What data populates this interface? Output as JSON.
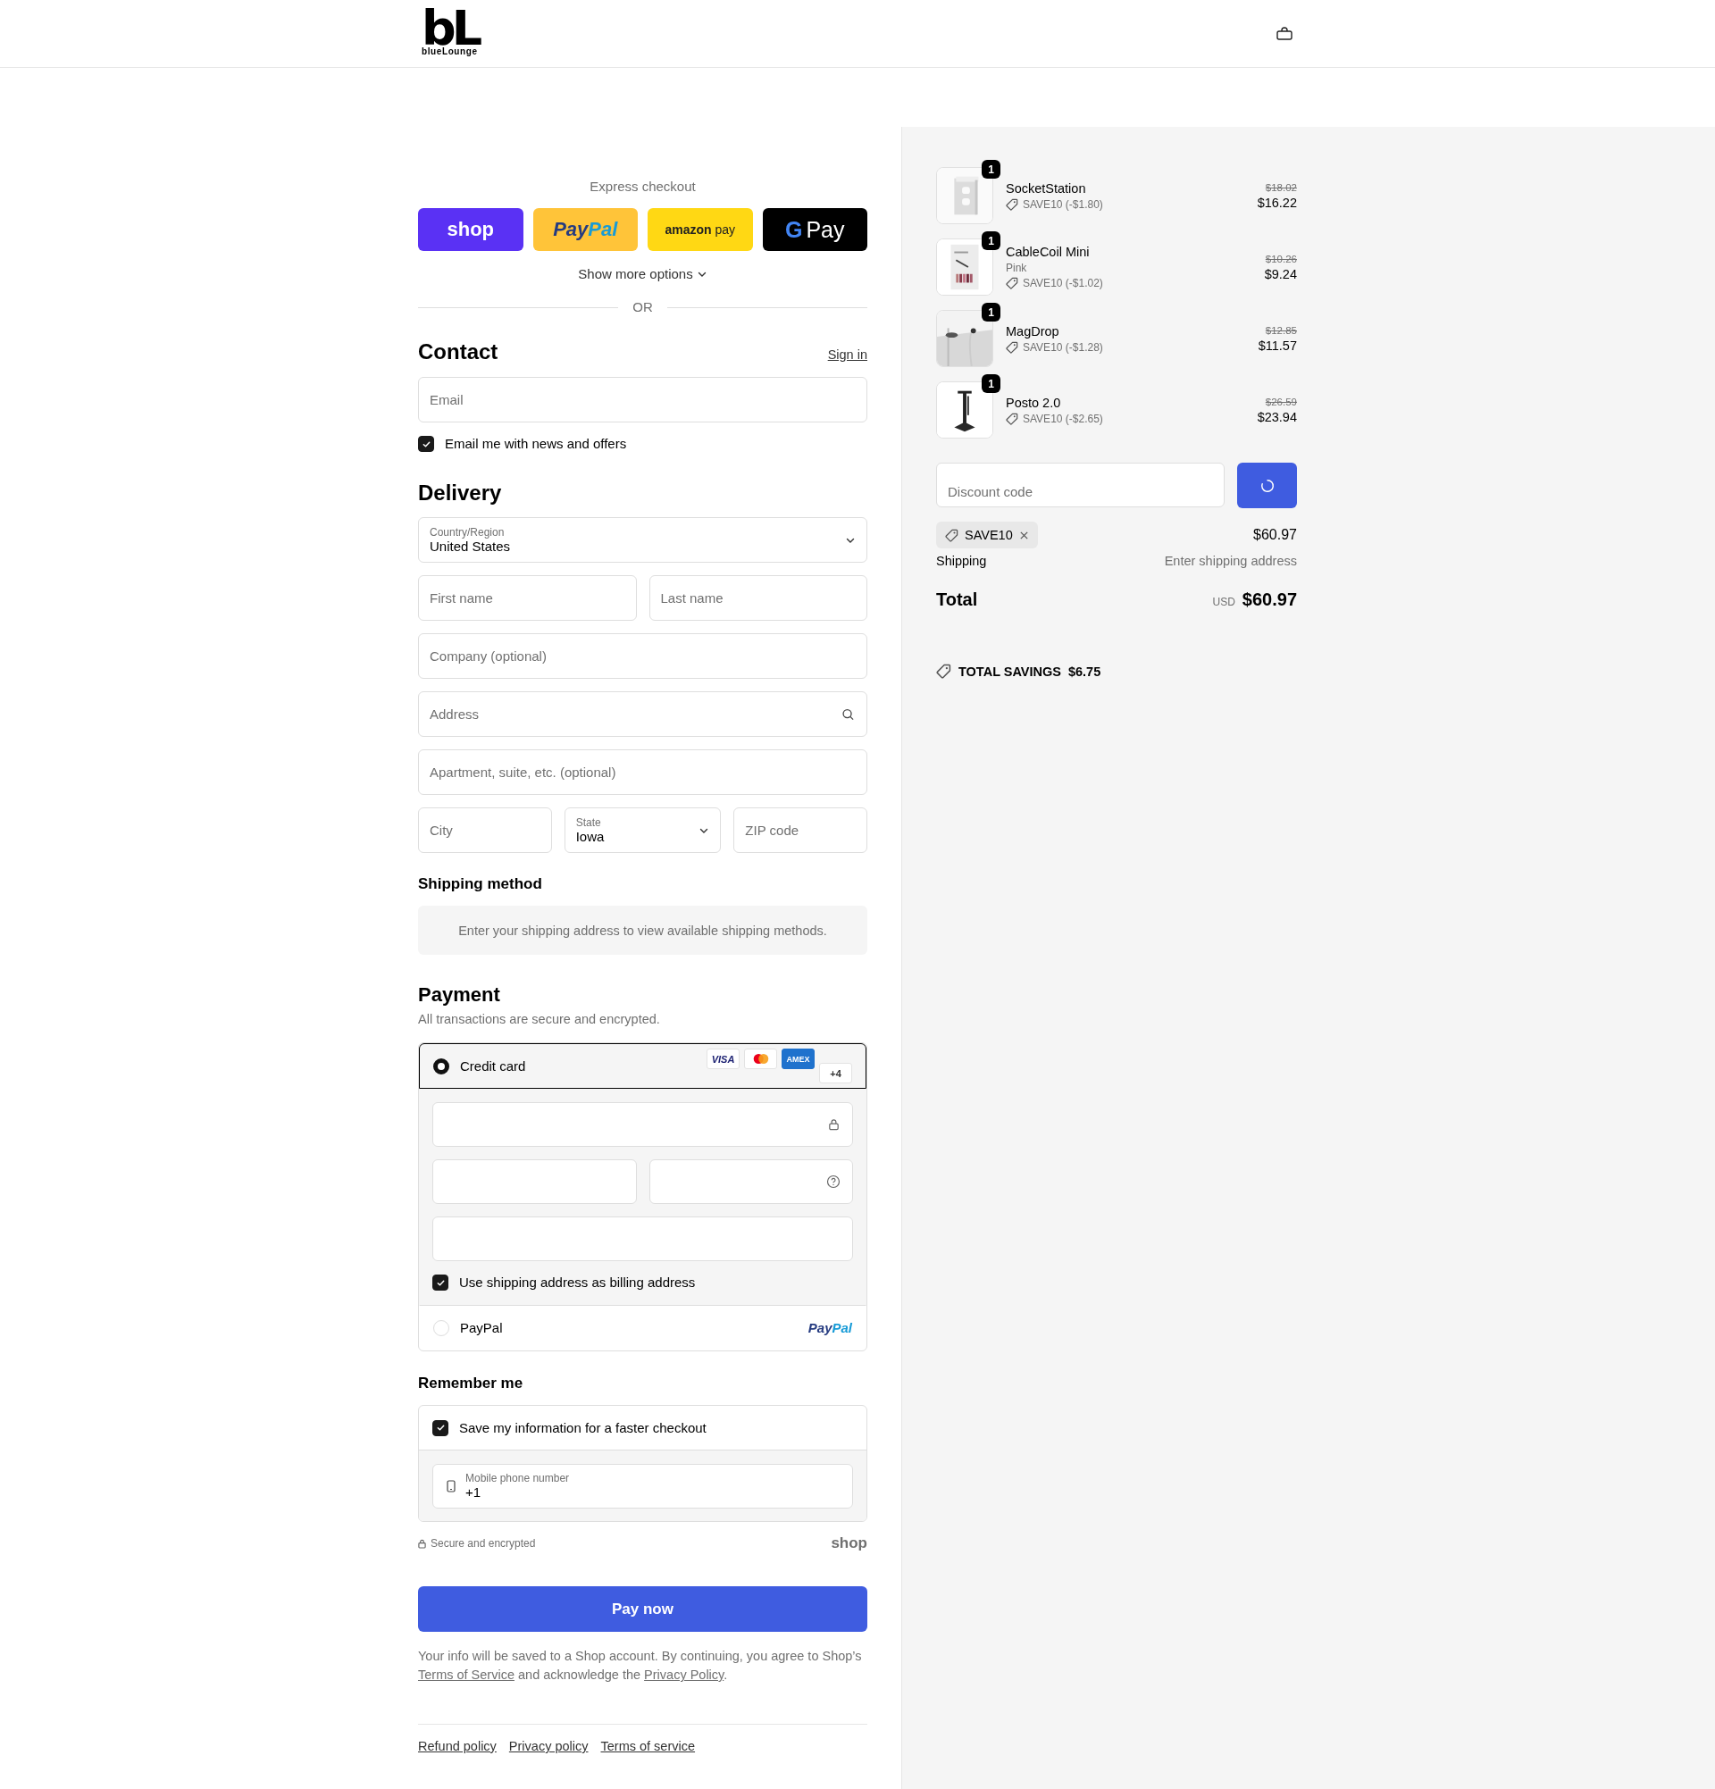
{
  "header": {
    "logo": {
      "mark": "bL",
      "wordmark": "blueLounge"
    }
  },
  "express_checkout": {
    "title": "Express checkout",
    "buttons": [
      {
        "kind": "shop",
        "parts": [
          "shop"
        ]
      },
      {
        "kind": "paypal",
        "parts": [
          "Pay",
          "Pal"
        ]
      },
      {
        "kind": "amazon",
        "parts": [
          "amazon",
          "pay"
        ]
      },
      {
        "kind": "gpay",
        "parts": [
          "G",
          "Pay"
        ]
      }
    ],
    "more_options": "Show more options",
    "divider": "OR"
  },
  "contact": {
    "title": "Contact",
    "sign_in": "Sign in",
    "email": {
      "placeholder": "Email"
    },
    "newsletter": {
      "label": "Email me with news and offers",
      "checked": true
    }
  },
  "delivery": {
    "title": "Delivery",
    "rows": [
      [
        {
          "kind": "select",
          "label": "Country/Region",
          "value": "United States"
        }
      ],
      [
        {
          "kind": "text",
          "placeholder": "First name"
        },
        {
          "kind": "text",
          "placeholder": "Last name"
        }
      ],
      [
        {
          "kind": "text",
          "placeholder": "Company (optional)"
        }
      ],
      [
        {
          "kind": "search",
          "placeholder": "Address"
        }
      ],
      [
        {
          "kind": "text",
          "placeholder": "Apartment, suite, etc. (optional)"
        }
      ],
      [
        {
          "kind": "text",
          "placeholder": "City"
        },
        {
          "kind": "select",
          "label": "State",
          "value": "Iowa"
        },
        {
          "kind": "text",
          "placeholder": "ZIP code"
        }
      ]
    ]
  },
  "shipping_method": {
    "title": "Shipping method",
    "notice": "Enter your shipping address to view available shipping methods."
  },
  "payment": {
    "title": "Payment",
    "subtitle": "All transactions are secure and encrypted.",
    "methods": [
      {
        "kind": "card",
        "label": "Credit card",
        "selected": true,
        "brands": [
          {
            "kind": "visa",
            "label": "VISA"
          },
          {
            "kind": "mastercard"
          },
          {
            "kind": "amex",
            "label": "AMEX"
          },
          {
            "kind": "more",
            "label": "+4"
          }
        ],
        "fields": [
          [
            {
              "kind": "secure"
            }
          ],
          [
            {
              "kind": "plain"
            },
            {
              "kind": "help"
            }
          ],
          [
            {
              "kind": "plain"
            }
          ]
        ],
        "billing": {
          "label": "Use shipping address as billing address",
          "checked": true
        }
      },
      {
        "kind": "paypal",
        "label": "PayPal",
        "selected": false,
        "logo": [
          "Pay",
          "Pal"
        ]
      }
    ]
  },
  "remember_me": {
    "title": "Remember me",
    "save": {
      "label": "Save my information for a faster checkout",
      "checked": true
    },
    "phone": {
      "label": "Mobile phone number",
      "value": "+1"
    },
    "secure_note": "Secure and encrypted",
    "shop_logo": "shop"
  },
  "pay_button": "Pay now",
  "legal": [
    {
      "kind": "text",
      "text": "Your info will be saved to a Shop account. By continuing, you agree to Shop’s "
    },
    {
      "kind": "link",
      "text": "Terms of Service"
    },
    {
      "kind": "text",
      "text": " and acknowledge the "
    },
    {
      "kind": "link",
      "text": "Privacy Policy"
    },
    {
      "kind": "text",
      "text": "."
    }
  ],
  "footer_links": [
    "Refund policy",
    "Privacy policy",
    "Terms of service"
  ],
  "order_summary": {
    "items": [
      {
        "name": "SocketStation",
        "quantity": "1",
        "discount": "SAVE10 (-$1.80)",
        "original_price": "$18.02",
        "price": "$16.22"
      },
      {
        "name": "CableCoil Mini",
        "variant": "Pink",
        "quantity": "1",
        "discount": "SAVE10 (-$1.02)",
        "original_price": "$10.26",
        "price": "$9.24"
      },
      {
        "name": "MagDrop",
        "quantity": "1",
        "discount": "SAVE10 (-$1.28)",
        "original_price": "$12.85",
        "price": "$11.57"
      },
      {
        "name": "Posto 2.0",
        "quantity": "1",
        "discount": "SAVE10 (-$2.65)",
        "original_price": "$26.59",
        "price": "$23.94"
      }
    ],
    "discount": {
      "placeholder": "Discount code",
      "loading": true
    },
    "applied_code": "SAVE10",
    "subtotal": "$60.97",
    "shipping": {
      "label": "Shipping",
      "value": "Enter shipping address"
    },
    "total": {
      "label": "Total",
      "currency": "USD",
      "value": "$60.97"
    },
    "savings": {
      "label": "TOTAL SAVINGS",
      "value": "$6.75"
    }
  }
}
